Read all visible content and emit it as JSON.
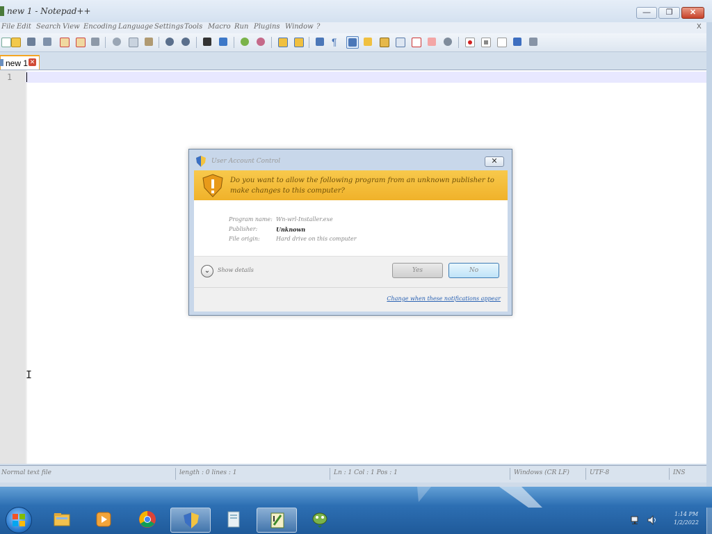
{
  "window": {
    "title": "new 1 - Notepad++",
    "buttons": {
      "minimize": "—",
      "restore": "❐",
      "close": "✕"
    }
  },
  "menu": [
    "File",
    "Edit",
    "Search",
    "View",
    "Encoding",
    "Language",
    "Settings",
    "Tools",
    "Macro",
    "Run",
    "Plugins",
    "Window",
    "?"
  ],
  "menu_close": "X",
  "editor": {
    "tab_label": "new 1",
    "tab_close": "✕",
    "line_number": "1",
    "text_cursor": "I"
  },
  "status": {
    "file_type": "Normal text file",
    "length": "length : 0    lines : 1",
    "position": "Ln : 1    Col : 1    Pos : 1",
    "eol": "Windows (CR LF)",
    "encoding": "UTF-8",
    "mode": "INS"
  },
  "uac": {
    "title": "User Account Control",
    "close": "✕",
    "question": "Do you want to allow the following program from an unknown publisher to make changes to this computer?",
    "fields": [
      {
        "label": "Program name:",
        "value": "Wn-wrl-Installer.exe"
      },
      {
        "label": "Publisher:",
        "value": "Unknown"
      },
      {
        "label": "File origin:",
        "value": "Hard drive on this computer"
      }
    ],
    "show_details": "Show details",
    "yes": "Yes",
    "no": "No",
    "change_link": "Change when these notifications appear"
  },
  "taskbar": {
    "clock_time": "1:14 PM",
    "clock_date": "1/2/2022"
  },
  "colors": {
    "banner": "#f0b22a",
    "accent_tab": "#f5a623",
    "taskbar": "#2d6fb3"
  }
}
